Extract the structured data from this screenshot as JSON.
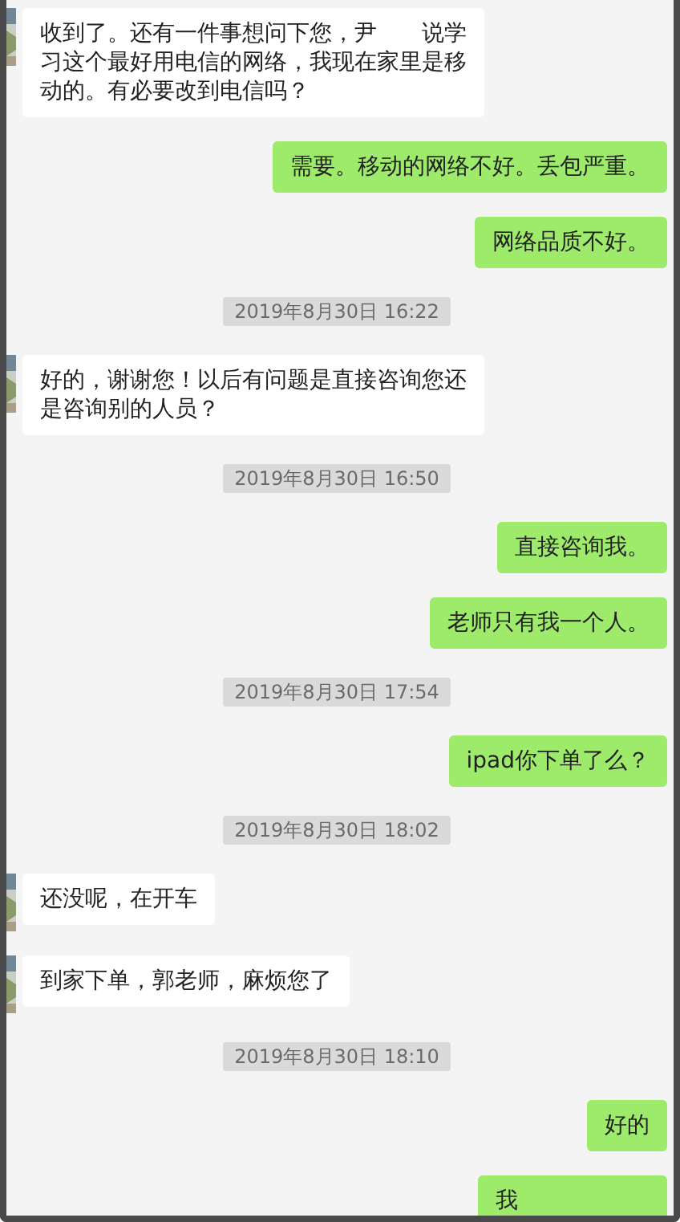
{
  "messages": [
    {
      "kind": "incoming",
      "text": "收到了。还有一件事想问下您，尹　　说学习这个最好用电信的网络，我现在家里是移动的。有必要改到电信吗？"
    },
    {
      "kind": "outgoing",
      "text": "需要。移动的网络不好。丢包严重。"
    },
    {
      "kind": "outgoing",
      "text": "网络品质不好。"
    },
    {
      "kind": "time",
      "text": "2019年8月30日 16:22"
    },
    {
      "kind": "incoming",
      "text": "好的，谢谢您！以后有问题是直接咨询您还是咨询别的人员？"
    },
    {
      "kind": "time",
      "text": "2019年8月30日 16:50"
    },
    {
      "kind": "outgoing",
      "text": "直接咨询我。"
    },
    {
      "kind": "outgoing",
      "text": "老师只有我一个人。"
    },
    {
      "kind": "time",
      "text": "2019年8月30日 17:54"
    },
    {
      "kind": "outgoing",
      "text": "ipad你下单了么？"
    },
    {
      "kind": "time",
      "text": "2019年8月30日 18:02"
    },
    {
      "kind": "incoming",
      "text": "还没呢，在开车"
    },
    {
      "kind": "incoming",
      "text": "到家下单，郭老师，麻烦您了"
    },
    {
      "kind": "time",
      "text": "2019年8月30日 18:10"
    },
    {
      "kind": "outgoing",
      "text": "好的"
    },
    {
      "kind": "outgoing",
      "text": "我"
    }
  ]
}
